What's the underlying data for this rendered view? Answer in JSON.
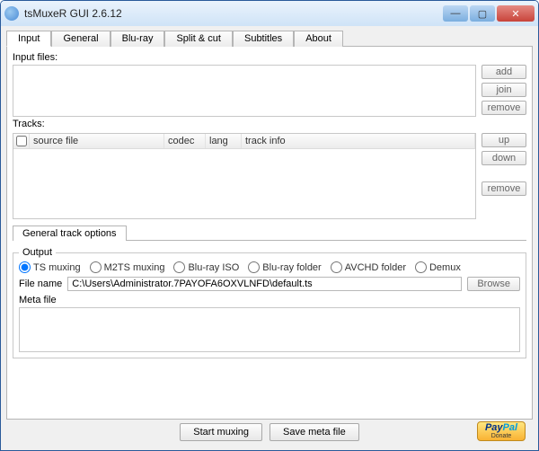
{
  "window": {
    "title": "tsMuxeR GUI 2.6.12"
  },
  "tabs": [
    "Input",
    "General",
    "Blu-ray",
    "Split & cut",
    "Subtitles",
    "About"
  ],
  "input": {
    "files_label": "Input files:",
    "btns": {
      "add": "add",
      "join": "join",
      "remove": "remove"
    },
    "tracks_label": "Tracks:",
    "cols": {
      "src": "source file",
      "codec": "codec",
      "lang": "lang",
      "info": "track info"
    },
    "tbtns": {
      "up": "up",
      "down": "down",
      "remove": "remove"
    },
    "gto": "General track options"
  },
  "output": {
    "legend": "Output",
    "radios": [
      "TS muxing",
      "M2TS muxing",
      "Blu-ray ISO",
      "Blu-ray folder",
      "AVCHD folder",
      "Demux"
    ],
    "file_label": "File name",
    "file_value": "C:\\Users\\Administrator.7PAYOFA6OXVLNFD\\default.ts",
    "browse": "Browse",
    "meta_label": "Meta file"
  },
  "bottom": {
    "start": "Start muxing",
    "save": "Save meta file",
    "paypal": "PayPal",
    "donate": "Donate"
  }
}
